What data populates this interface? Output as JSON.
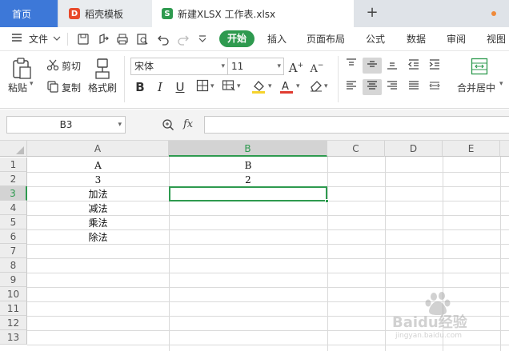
{
  "tabs": {
    "home": "首页",
    "daoke": "稻壳模板",
    "daoke_logo": "D",
    "file": "新建XLSX 工作表.xlsx",
    "file_logo": "S",
    "add": "+"
  },
  "menu": {
    "file": "文件",
    "start": "开始",
    "insert": "插入",
    "layout": "页面布局",
    "formula": "公式",
    "data": "数据",
    "review": "审阅",
    "view": "视图"
  },
  "ribbon": {
    "paste": "粘贴",
    "cut": "剪切",
    "copy": "复制",
    "format_painter": "格式刷",
    "font_name": "宋体",
    "font_size": "11",
    "merge_center": "合并居中"
  },
  "formula_bar": {
    "name_box": "B3",
    "fx": "fx"
  },
  "sheet": {
    "columns": [
      "A",
      "B",
      "C",
      "D",
      "E"
    ],
    "rows": [
      "1",
      "2",
      "3",
      "4",
      "5",
      "6",
      "7",
      "8",
      "9",
      "10",
      "11",
      "12",
      "13"
    ],
    "active_cell": "B3",
    "cells": {
      "A1": "A",
      "B1": "B",
      "A2": "3",
      "B2": "2",
      "A3": "加法",
      "A4": "减法",
      "A5": "乘法",
      "A6": "除法"
    }
  },
  "watermark": {
    "brand": "Baidu经验",
    "url": "jingyan.baidu.com"
  },
  "colors": {
    "accent_green": "#2e9a4f",
    "home_tab_blue": "#3d78d8",
    "unsaved_dot": "#ef8a3a"
  }
}
